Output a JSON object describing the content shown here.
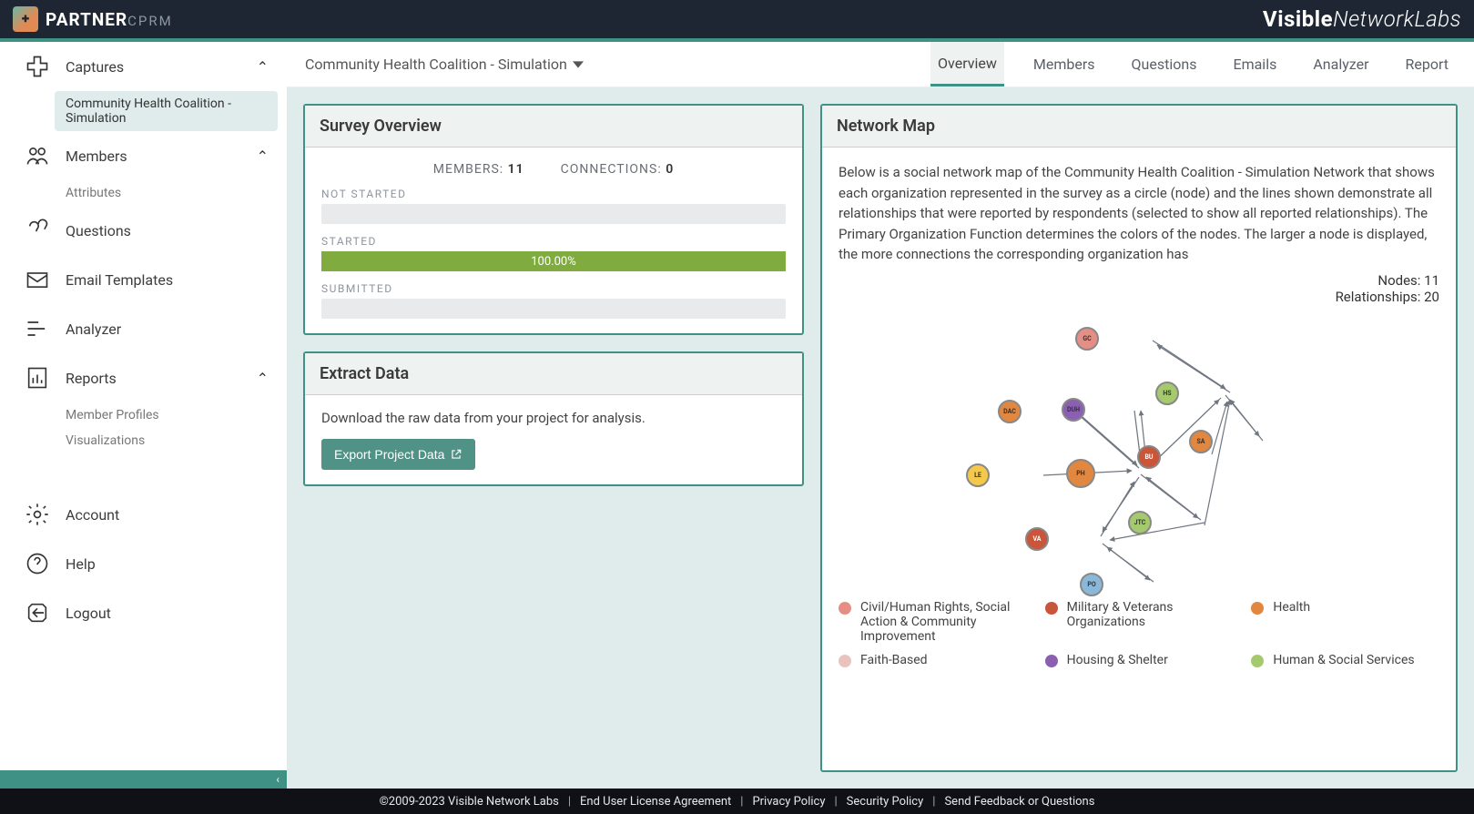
{
  "header": {
    "brand_main": "PARTNER",
    "brand_sub": "CPRM",
    "brand_right_bold": "Visible",
    "brand_right_rest": "NetworkLabs"
  },
  "sidebar": {
    "captures": "Captures",
    "captures_sub": "Community Health Coalition - Simulation",
    "members": "Members",
    "members_sub": "Attributes",
    "questions": "Questions",
    "email_templates": "Email Templates",
    "analyzer": "Analyzer",
    "reports": "Reports",
    "reports_sub1": "Member Profiles",
    "reports_sub2": "Visualizations",
    "account": "Account",
    "help": "Help",
    "logout": "Logout"
  },
  "project": {
    "title": "Community Health Coalition - Simulation"
  },
  "tabs": [
    "Overview",
    "Members",
    "Questions",
    "Emails",
    "Analyzer",
    "Report"
  ],
  "survey": {
    "title": "Survey Overview",
    "members_label": "MEMBERS:",
    "members_count": "11",
    "connections_label": "CONNECTIONS:",
    "connections_count": "0",
    "not_started_label": "NOT STARTED",
    "started_label": "STARTED",
    "started_pct": "100.00%",
    "submitted_label": "SUBMITTED"
  },
  "extract": {
    "title": "Extract Data",
    "desc": "Download the raw data from your project for analysis.",
    "button": "Export Project Data"
  },
  "map": {
    "title": "Network Map",
    "desc": "Below is a social network map of the Community Health Coalition - Simulation Network that shows each organization represented in the survey as a circle (node) and the lines shown demonstrate all relationships that were reported by respondents (selected to show all reported relationships). The Primary Organization Function determines the colors of the nodes. The larger a node is displayed, the more connections the corresponding organization has",
    "nodes_label": "Nodes: 11",
    "rel_label": "Relationships: 20",
    "legend": [
      {
        "color": "#e48e86",
        "label": "Civil/Human Rights, Social Action & Community Improvement"
      },
      {
        "color": "#c9553a",
        "label": "Military & Veterans Organizations"
      },
      {
        "color": "#e1873f",
        "label": "Health"
      },
      {
        "color": "#e9c4be",
        "label": "Faith-Based"
      },
      {
        "color": "#8b60b3",
        "label": "Housing & Shelter"
      },
      {
        "color": "#a5ca6e",
        "label": "Human & Social Services"
      }
    ],
    "node_labels": {
      "gc": "GC",
      "hs": "HS",
      "dac": "DAC",
      "duh": "DUH",
      "sa": "SA",
      "bu": "BU",
      "le": "LE",
      "ph": "PH",
      "jtc": "JTC",
      "va": "VA",
      "po": "PO"
    }
  },
  "footer": {
    "copyright": "©2009-2023 Visible Network Labs",
    "links": [
      "End User License Agreement",
      "Privacy Policy",
      "Security Policy",
      "Send Feedback or Questions"
    ]
  }
}
